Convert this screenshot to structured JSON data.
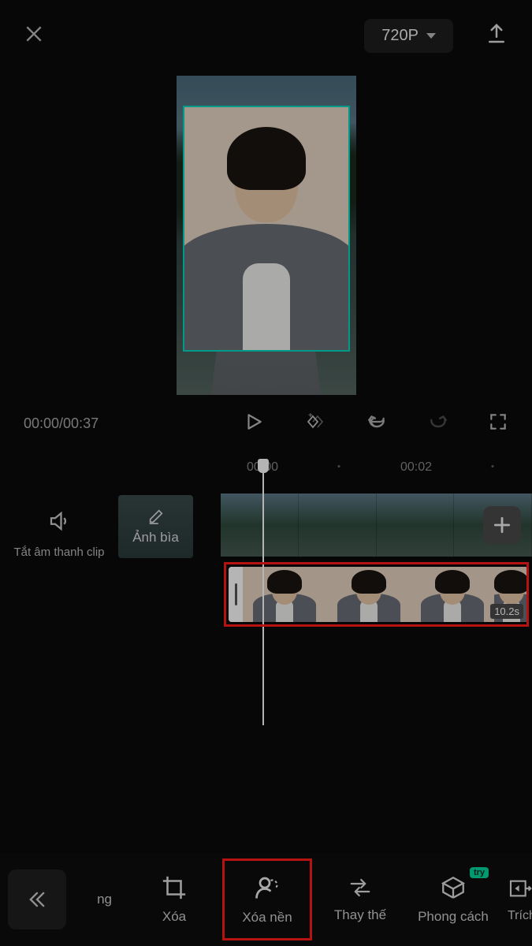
{
  "topbar": {
    "resolution_label": "720P"
  },
  "playback": {
    "time_display": "00:00/00:37"
  },
  "ruler": {
    "marks": [
      "00:00",
      "00:02"
    ]
  },
  "side": {
    "mute_label": "Tắt âm thanh clip",
    "cover_label": "Ảnh bìa"
  },
  "overlay_clip": {
    "duration": "10.2s"
  },
  "toolbar": {
    "items": [
      {
        "id": "ng",
        "label": "ng"
      },
      {
        "id": "xoa",
        "label": "Xóa"
      },
      {
        "id": "xoa-nen",
        "label": "Xóa nền"
      },
      {
        "id": "thay-the",
        "label": "Thay thế"
      },
      {
        "id": "phong-cach",
        "label": "Phong cách",
        "badge": "try"
      },
      {
        "id": "trich-xuat",
        "label": "Trích xuất thanh"
      }
    ]
  }
}
